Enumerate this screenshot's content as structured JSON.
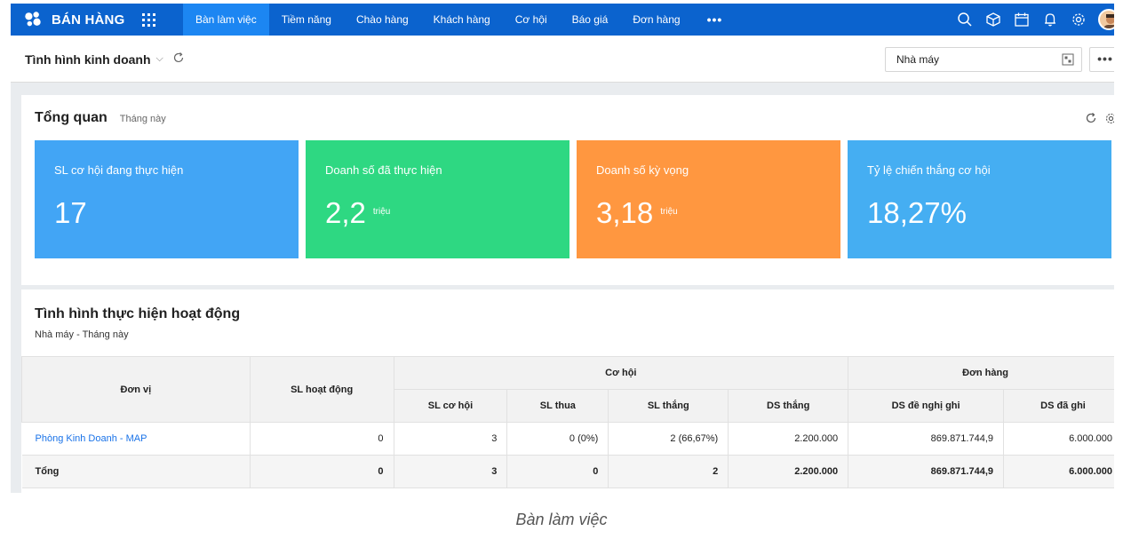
{
  "topbar": {
    "app_name": "BÁN HÀNG",
    "tabs": [
      "Bàn làm việc",
      "Tiềm năng",
      "Chào hàng",
      "Khách hàng",
      "Cơ hội",
      "Báo giá",
      "Đơn hàng"
    ],
    "active_tab": "Bàn làm việc",
    "more": "•••",
    "icons": [
      "search-icon",
      "box-icon",
      "calendar-icon",
      "bell-icon",
      "gear-icon",
      "avatar"
    ],
    "color": "#0b63ce",
    "active_color": "#1c86f2"
  },
  "subbar": {
    "title": "Tình hình kinh doanh",
    "chevron": "⌵",
    "filter_value": "Nhà máy",
    "more": "•••"
  },
  "overview": {
    "title": "Tổng quan",
    "period": "Tháng này",
    "tiles": [
      {
        "label": "SL cơ hội đang thực hiện",
        "value": "17",
        "unit": "",
        "color": "#42a5f5"
      },
      {
        "label": "Doanh số đã thực hiện",
        "value": "2,2",
        "unit": "triệu",
        "color": "#2ed882"
      },
      {
        "label": "Doanh số kỳ vọng",
        "value": "3,18",
        "unit": "triệu",
        "color": "#ff9740"
      },
      {
        "label": "Tỷ lệ chiến thắng cơ hội",
        "value": "18,27%",
        "unit": "",
        "color": "#45aef2"
      }
    ]
  },
  "activity": {
    "title": "Tình hình thực hiện hoạt động",
    "subtitle": "Nhà máy  - Tháng này",
    "headers": {
      "unit": "Đơn vị",
      "activities": "SL hoạt động",
      "group_opportunity": "Cơ hội",
      "group_order": "Đơn hàng",
      "sub": [
        "SL cơ hội",
        "SL thua",
        "SL thắng",
        "DS thắng",
        "DS đề nghị ghi",
        "DS đã ghi"
      ]
    },
    "rows": [
      {
        "unit": "Phòng Kinh Doanh - MAP",
        "cells": [
          "0",
          "3",
          "0 (0%)",
          "2 (66,67%)",
          "2.200.000",
          "869.871.744,9",
          "6.000.000"
        ]
      },
      {
        "unit": "Tổng",
        "cells": [
          "0",
          "3",
          "0",
          "2",
          "2.200.000",
          "869.871.744,9",
          "6.000.000"
        ]
      }
    ]
  },
  "caption": "Bàn làm việc"
}
